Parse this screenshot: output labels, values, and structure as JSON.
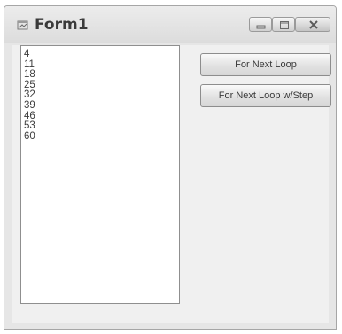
{
  "window": {
    "title": "Form1"
  },
  "listbox": {
    "items": [
      "4",
      "11",
      "18",
      "25",
      "32",
      "39",
      "46",
      "53",
      "60"
    ]
  },
  "buttons": {
    "for_next_loop": "For Next Loop",
    "for_next_loop_step": "For Next Loop w/Step"
  }
}
